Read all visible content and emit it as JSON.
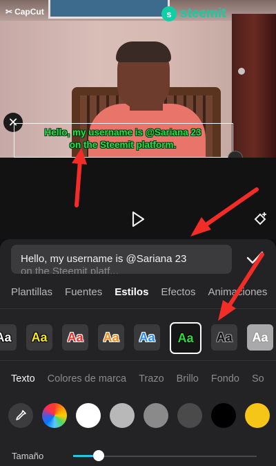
{
  "overlay": {
    "capcut_label": "CapCut",
    "steemit_label": "steemit",
    "caption_line1": "Hello, my username is @Sariana 23",
    "caption_line2": "on the Steemit platform."
  },
  "editor": {
    "text_value": "Hello, my username is @Sariana 23",
    "text_value_line2": "on the Steemit platf..."
  },
  "tabs": [
    {
      "label": "Plantillas"
    },
    {
      "label": "Fuentes"
    },
    {
      "label": "Estilos",
      "active": true
    },
    {
      "label": "Efectos"
    },
    {
      "label": "Animaciones"
    }
  ],
  "style_presets": [
    {
      "label": "Aa",
      "fill": "#ffffff",
      "outline": "#000000"
    },
    {
      "label": "Aa",
      "fill": "#f7e81a",
      "outline": "#000000"
    },
    {
      "label": "Aa",
      "fill": "#e8322f",
      "outline": "#ffffff"
    },
    {
      "label": "Aa",
      "fill": "#f08a1c",
      "outline": "#ffffff"
    },
    {
      "label": "Aa",
      "fill": "#2a8cf0",
      "outline": "#ffffff"
    },
    {
      "label": "Aa",
      "fill": "#2bdc3a",
      "outline": "#000000",
      "selected": true
    },
    {
      "label": "Aa",
      "fill": "#111111",
      "outline": "#999999"
    },
    {
      "label": "Aa",
      "fill": "#ffffff",
      "outline": "#999999"
    }
  ],
  "subtabs": [
    {
      "label": "Texto",
      "active": true
    },
    {
      "label": "Colores de marca"
    },
    {
      "label": "Trazo"
    },
    {
      "label": "Brillo"
    },
    {
      "label": "Fondo"
    },
    {
      "label": "So"
    }
  ],
  "colors": [
    "#ffffff",
    "#b8b8b8",
    "#8a8a8a",
    "#4a4a4a",
    "#000000",
    "#f5c518"
  ],
  "size": {
    "label": "Tamaño",
    "value": 0.14
  },
  "accent": "#26c6e3"
}
